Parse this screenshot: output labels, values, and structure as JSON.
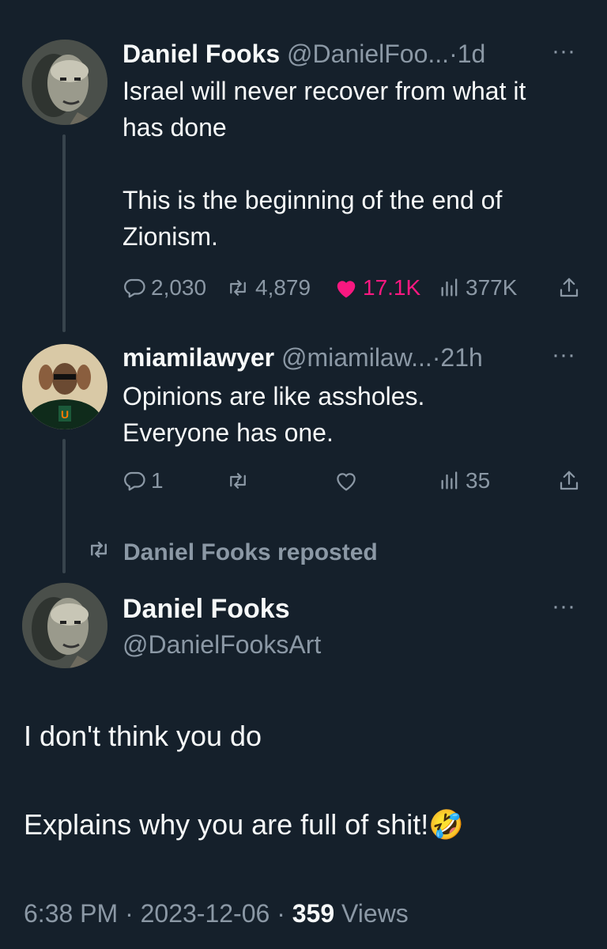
{
  "tweet1": {
    "name": "Daniel Fooks",
    "handle": "@DanielFoo...",
    "sep": "·",
    "time": "1d",
    "more": "···",
    "line1": "Israel will never recover from what it",
    "line2": "has done",
    "line3": "This is the beginning of the end of",
    "line4": "Zionism.",
    "replies": "2,030",
    "reposts": "4,879",
    "likes": "17.1K",
    "views": "377K"
  },
  "tweet2": {
    "name": "miamilawyer",
    "handle": "@miamilaw...",
    "sep": "·",
    "time": "21h",
    "more": "···",
    "line1": "Opinions are like assholes.",
    "line2": "Everyone has one.",
    "replies": "1",
    "views": "35"
  },
  "repost_banner": "Daniel Fooks reposted",
  "main": {
    "name": "Daniel Fooks",
    "handle": "@DanielFooksArt",
    "more": "···",
    "line1": "I don't think you do",
    "line2": "Explains why you are full of shit!",
    "emoji": "🤣",
    "time": "6:38 PM",
    "sep": "·",
    "date": "2023-12-06",
    "views_count": "359",
    "views_label": "Views"
  },
  "colors": {
    "background": "#15202b",
    "secondary_text": "#8b98a5",
    "like_pink": "#f91880"
  },
  "icons": [
    "reply-icon",
    "repost-icon",
    "like-icon",
    "views-icon",
    "share-icon",
    "more-icon"
  ]
}
